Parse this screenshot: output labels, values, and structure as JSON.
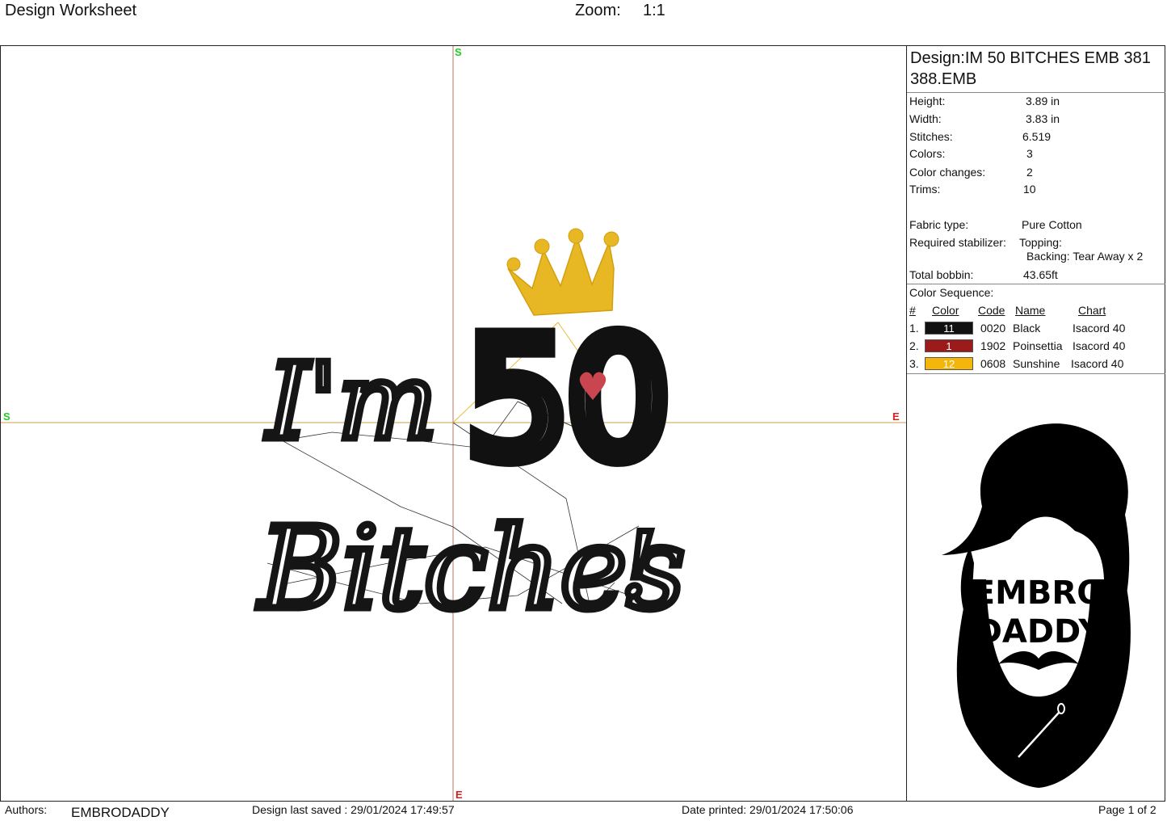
{
  "header": {
    "title": "Design Worksheet",
    "zoom_label": "Zoom:",
    "zoom_value": "1:1"
  },
  "canvas": {
    "axis_start_top": "S",
    "axis_start_left": "S",
    "axis_end_right": "E",
    "axis_end_bottom": "E",
    "design_text_line1": "I'm",
    "design_number": "50",
    "design_text_line2": "Bitches",
    "design_exclamation": "!"
  },
  "design": {
    "title": "Design:IM 50 BITCHES EMB 381 388.EMB",
    "stats": [
      {
        "label": "Height:",
        "value": "3.89 in"
      },
      {
        "label": "Width:",
        "value": "3.83 in"
      },
      {
        "label": "Stitches:",
        "value": "6.519"
      },
      {
        "label": "Colors:",
        "value": "3"
      },
      {
        "label": "Color changes:",
        "value": "2"
      },
      {
        "label": "Trims:",
        "value": "10"
      }
    ],
    "fabric_label": "Fabric type:",
    "fabric_value": "Pure Cotton",
    "stabilizer_label": "Required stabilizer:",
    "topping_label": "Topping:",
    "backing_label": "Backing: Tear Away x 2",
    "bobbin_label": "Total bobbin:",
    "bobbin_value": "43.65ft"
  },
  "color_sequence": {
    "title": "Color Sequence:",
    "headers": {
      "num": "#",
      "color": "Color",
      "code": "Code",
      "name": "Name",
      "chart": "Chart"
    },
    "rows": [
      {
        "num": "1.",
        "swatch_label": "11",
        "swatch_color": "#111111",
        "code": "0020",
        "name": "Black",
        "chart": "Isacord 40"
      },
      {
        "num": "2.",
        "swatch_label": "1",
        "swatch_color": "#9b1b1b",
        "code": "1902",
        "name": "Poinsettia",
        "chart": "Isacord 40"
      },
      {
        "num": "3.",
        "swatch_label": "12",
        "swatch_color": "#f5b60a",
        "code": "0608",
        "name": "Sunshine",
        "chart": "Isacord 40"
      }
    ]
  },
  "logo": {
    "line1": "EMBRO",
    "line2": "DADDY"
  },
  "footer": {
    "authors_label": "Authors:",
    "authors_value": "EMBRODADDY",
    "saved": "Design last saved : 29/01/2024 17:49:57",
    "printed": "Date printed: 29/01/2024 17:50:06",
    "page": "Page 1 of 2"
  },
  "colors": {
    "crown": "#e8b724",
    "heart": "#c9454f",
    "axis_h": "#c8a24a",
    "axis_v": "#b07a6a",
    "start_marker": "#22cc22",
    "end_marker": "#cc2222"
  }
}
